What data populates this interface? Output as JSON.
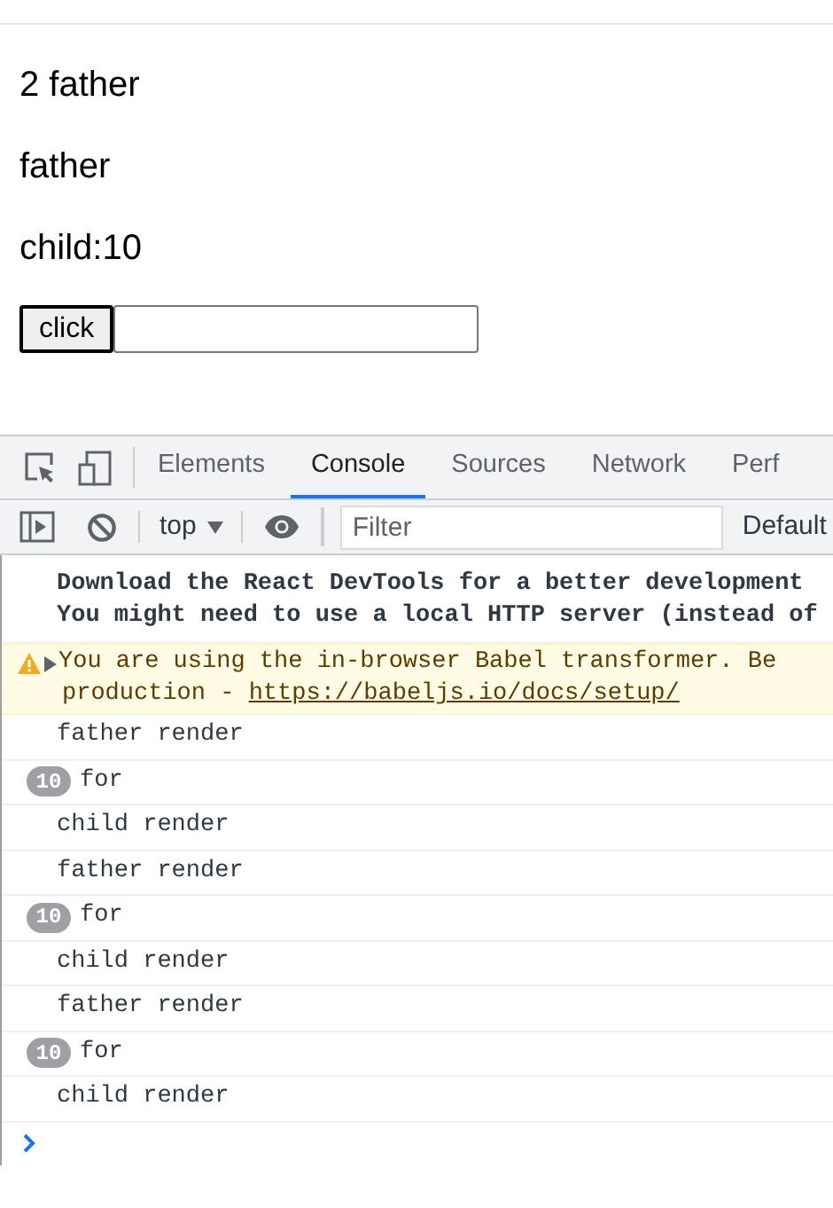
{
  "page": {
    "lines": [
      "2 father",
      "father",
      "child:10"
    ],
    "button": "click"
  },
  "devtools": {
    "tabs": [
      {
        "label": "Elements",
        "selected": false
      },
      {
        "label": "Console",
        "selected": true
      },
      {
        "label": "Sources",
        "selected": false
      },
      {
        "label": "Network",
        "selected": false
      },
      {
        "label": "Perf",
        "selected": false
      }
    ],
    "context": "top",
    "filter": {
      "placeholder": "Filter"
    },
    "levels": "Default"
  },
  "console": [
    {
      "kind": "info",
      "lines": [
        "Download the React DevTools for a better development",
        "You might need to use a local HTTP server (instead of"
      ]
    },
    {
      "kind": "warning",
      "text": "You are using the in-browser Babel transformer. Be",
      "text2": "production - ",
      "link": "https://babeljs.io/docs/setup/"
    },
    {
      "kind": "log",
      "text": "father render"
    },
    {
      "kind": "log",
      "count": "10",
      "text": "for"
    },
    {
      "kind": "log",
      "text": "child render"
    },
    {
      "kind": "log",
      "text": "father render"
    },
    {
      "kind": "log",
      "count": "10",
      "text": "for"
    },
    {
      "kind": "log",
      "text": "child render"
    },
    {
      "kind": "log",
      "text": "father render"
    },
    {
      "kind": "log",
      "count": "10",
      "text": "for"
    },
    {
      "kind": "log",
      "text": "child render"
    }
  ]
}
